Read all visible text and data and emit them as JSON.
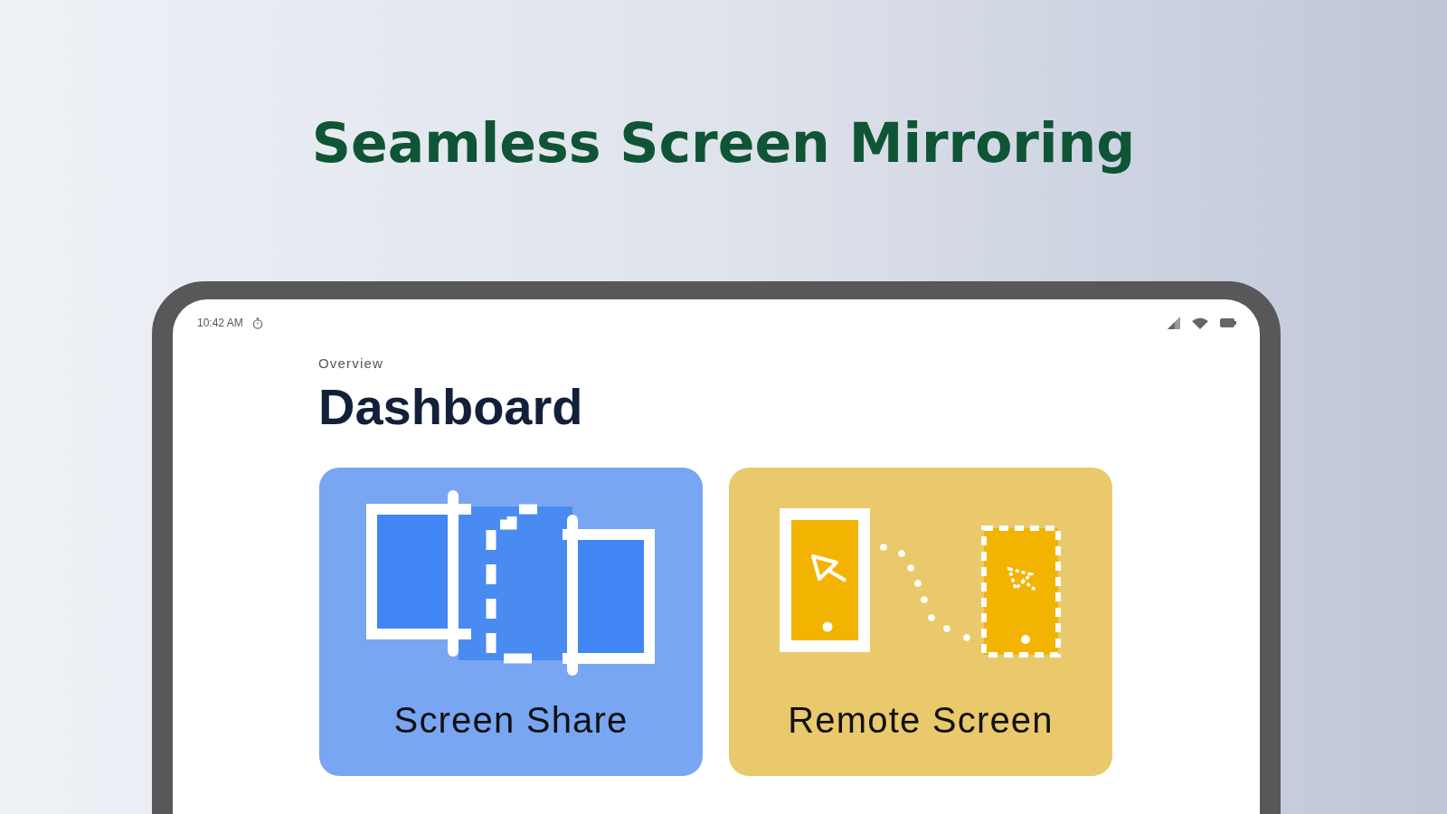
{
  "headline": "Seamless Screen Mirroring",
  "status_bar": {
    "time": "10:42 AM"
  },
  "screen": {
    "eyebrow": "Overview",
    "title": "Dashboard"
  },
  "cards": [
    {
      "kind": "screen_share",
      "label": "Screen Share",
      "color": "#78a6f2"
    },
    {
      "kind": "remote_screen",
      "label": "Remote Screen",
      "color": "#e9c96b"
    }
  ]
}
